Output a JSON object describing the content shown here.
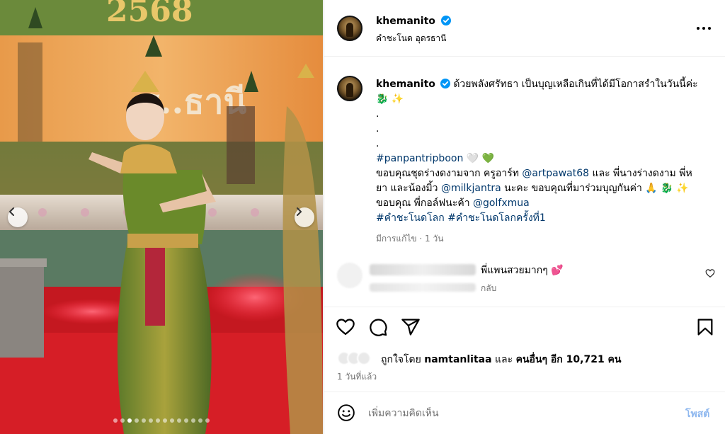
{
  "post": {
    "username": "khemanito",
    "location": "คำชะโนด อุดรธานี",
    "verified": true
  },
  "media": {
    "banner_text": "2568",
    "banner_text_2": "ร..ธานี",
    "carousel": {
      "count": 14,
      "active_index": 2
    },
    "icons": {
      "prev": "chevron-left-icon",
      "next": "chevron-right-icon"
    }
  },
  "caption": {
    "username": "khemanito",
    "line1": "ด้วยพลังศรัทธา เป็นบุญเหลือเกินที่ได้มีโอกาสรำในวันนี้ค่ะ",
    "line2_emoji": "🐉 ✨",
    "dots": [
      ".",
      ".",
      "."
    ],
    "hashtag1": "#panpantripboon",
    "hashtag1_emoji": "🤍 💚",
    "thanks1_prefix": "ขอบคุณชุดร่างดงามจาก ครูอาร์ท",
    "mention1": "@artpawat68",
    "thanks1_suffix": "และ พี่นางร่างดงาม พี่ห",
    "line_b_prefix": "ยา และน้องมิ้ว",
    "mention2": "@milkjantra",
    "line_b_suffix": "นะคะ ขอบคุณที่มาร่วมบุญกันค่า 🙏 🐉 ✨",
    "line_c_prefix": "ขอบคุณ พี่กอล์ฟนะค้า",
    "mention3": "@golfxmua",
    "hashtag2": "#คำชะโนดโลก",
    "hashtag3": "#คำชะโนดโลกครั้งที่1",
    "edited_meta": "มีการแก้ไข · 1 วัน"
  },
  "comment": {
    "text": "พี่แพนสวยมากๆ 💕",
    "reply_label": "กลับ"
  },
  "actions": {
    "like": "heart-icon",
    "comment": "comment-icon",
    "share": "send-icon",
    "save": "bookmark-icon"
  },
  "likes": {
    "prefix": "ถูกใจโดย",
    "user": "namtanlitaa",
    "and": "และ",
    "others": "คนอื่นๆ อีก 10,721 คน"
  },
  "time_ago": "1 วันที่แล้ว",
  "composer": {
    "placeholder": "เพิ่มความคิดเห็น",
    "post_label": "โพสต์",
    "emoji_icon": "smiley-icon"
  },
  "colors": {
    "link": "#00376b",
    "secondary": "#737373",
    "post_disabled": "#8fb8ef",
    "verified": "#0095f6",
    "comment_heart": "#e0245e"
  }
}
